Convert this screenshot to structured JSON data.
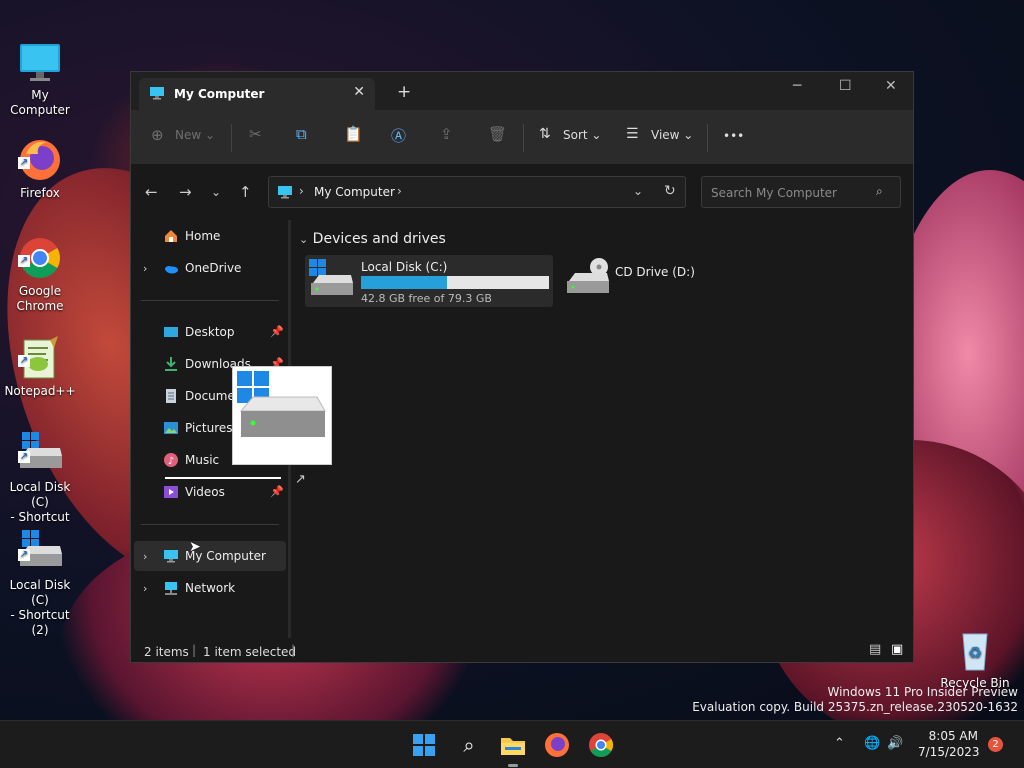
{
  "desktop": {
    "icons": [
      {
        "label": "My Computer"
      },
      {
        "label": "Firefox"
      },
      {
        "label": "Google\nChrome"
      },
      {
        "label": "Notepad++"
      },
      {
        "label": "Local Disk (C)\n- Shortcut"
      },
      {
        "label": "Local Disk (C)\n- Shortcut (2)"
      },
      {
        "label": "Recycle Bin"
      }
    ],
    "watermark_line1": "Windows 11 Pro Insider Preview",
    "watermark_line2": "Evaluation copy. Build 25375.zn_release.230520-1632"
  },
  "explorer": {
    "tab_title": "My Computer",
    "toolbar": {
      "new_label": "New",
      "sort_label": "Sort",
      "view_label": "View",
      "more_label": "•••"
    },
    "address": {
      "path": "My Computer"
    },
    "search": {
      "placeholder": "Search My Computer"
    },
    "sidebar": {
      "home": "Home",
      "onedrive": "OneDrive",
      "desktop": "Desktop",
      "downloads": "Downloads",
      "documents": "Docume",
      "pictures": "Pictures",
      "music": "Music",
      "videos": "Videos",
      "my_computer": "My Computer",
      "network": "Network"
    },
    "content": {
      "group_title": "Devices and drives",
      "drives": [
        {
          "name": "Local Disk (C:)",
          "free_text": "42.8 GB free of 79.3 GB",
          "used_fraction": 0.46
        },
        {
          "name": "CD Drive (D:)"
        }
      ]
    },
    "status": {
      "items": "2 items",
      "selected": "1 item selected"
    }
  },
  "taskbar": {
    "time": "8:05 AM",
    "date": "7/15/2023",
    "notification_count": "2"
  },
  "colors": {
    "accent": "#0078d4",
    "window_bg": "#191919",
    "taskbar_bg": "#1c1c1c"
  }
}
